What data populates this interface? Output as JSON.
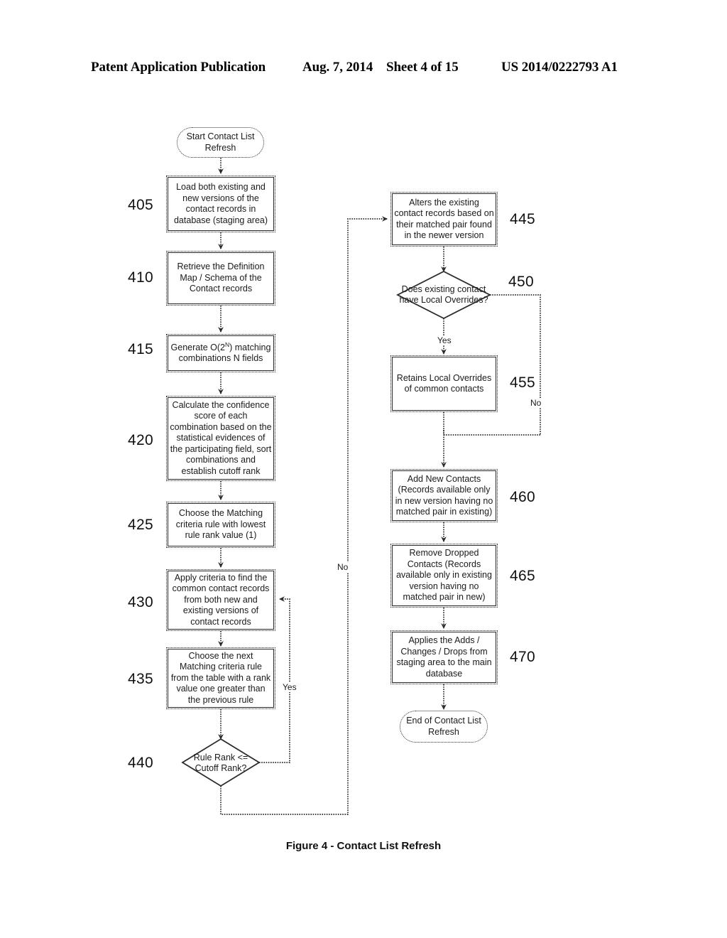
{
  "header": {
    "publication": "Patent Application Publication",
    "date": "Aug. 7, 2014",
    "sheet": "Sheet 4 of 15",
    "patent_number": "US 2014/0222793 A1"
  },
  "figure": {
    "caption": "Figure 4 - Contact List Refresh"
  },
  "flowchart": {
    "title": "Contact List Refresh",
    "nodes": {
      "start": {
        "shape": "terminator",
        "text": "Start Contact List Refresh"
      },
      "n405": {
        "ref": "405",
        "shape": "process",
        "text": "Load both existing and new versions of the contact records in database (staging area)"
      },
      "n410": {
        "ref": "410",
        "shape": "process",
        "text": "Retrieve the Definition Map / Schema of the Contact records"
      },
      "n415": {
        "ref": "415",
        "shape": "process",
        "text_pre": "Generate O(2",
        "text_sup": "N",
        "text_post": ") matching combinations N fields",
        "text": "Generate O(2N) matching combinations N fields"
      },
      "n420": {
        "ref": "420",
        "shape": "process",
        "text": "Calculate the confidence score of each combination based on the statistical evidences of the participating field, sort combinations and establish cutoff rank"
      },
      "n425": {
        "ref": "425",
        "shape": "process",
        "text": "Choose the Matching criteria rule with lowest rule rank value (1)"
      },
      "n430": {
        "ref": "430",
        "shape": "process",
        "text": "Apply criteria to find the common contact records from both new and existing versions of contact records"
      },
      "n435": {
        "ref": "435",
        "shape": "process",
        "text": "Choose the next Matching criteria rule from the table with a rank value one greater than the previous rule"
      },
      "n440": {
        "ref": "440",
        "shape": "decision",
        "text": "Rule Rank  <= Cutoff Rank?"
      },
      "n445": {
        "ref": "445",
        "shape": "process",
        "text": "Alters the existing contact records based on their matched pair found in the newer version"
      },
      "n450": {
        "ref": "450",
        "shape": "decision",
        "text": "Does existing contact have Local Overrides?"
      },
      "n455": {
        "ref": "455",
        "shape": "process",
        "text": "Retains Local Overrides of common contacts"
      },
      "n460": {
        "ref": "460",
        "shape": "process",
        "text": "Add New Contacts (Records available only in new version having no matched pair in existing)"
      },
      "n465": {
        "ref": "465",
        "shape": "process",
        "text": "Remove Dropped Contacts (Records available only in existing version having no matched pair in new)"
      },
      "n470": {
        "ref": "470",
        "shape": "process",
        "text": "Applies the Adds / Changes / Drops from staging area to the main database"
      },
      "end": {
        "shape": "terminator",
        "text": "End of Contact List Refresh"
      }
    },
    "edge_labels": {
      "yes_440": "Yes",
      "no_440": "No",
      "yes_450": "Yes",
      "no_450": "No"
    }
  }
}
